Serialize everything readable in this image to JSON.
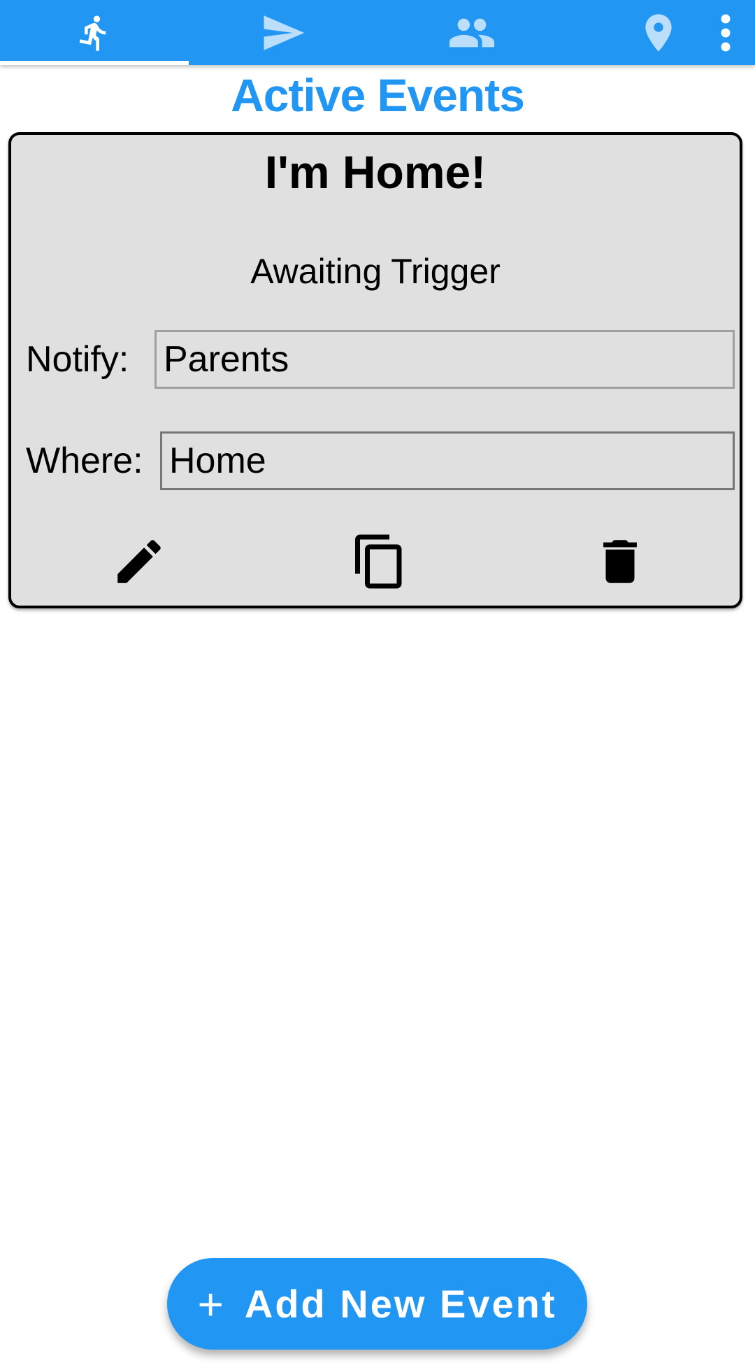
{
  "tabs": [
    {
      "id": "events",
      "icon": "run-icon",
      "selected": true
    },
    {
      "id": "send",
      "icon": "send-icon",
      "selected": false
    },
    {
      "id": "contacts",
      "icon": "people-icon",
      "selected": false
    },
    {
      "id": "places",
      "icon": "location-pin-icon",
      "selected": false
    }
  ],
  "overflow_icon": "more-vert-icon",
  "page": {
    "title": "Active Events"
  },
  "events": [
    {
      "title": "I'm Home!",
      "status": "Awaiting Trigger",
      "notify_label": "Notify:",
      "notify_value": "Parents",
      "where_label": "Where:",
      "where_value": "Home",
      "actions": [
        "edit-icon",
        "copy-icon",
        "delete-icon"
      ]
    }
  ],
  "fab": {
    "icon": "+",
    "label": "Add New Event"
  },
  "colors": {
    "primary": "#2196F3",
    "card_bg": "#e0e0e0",
    "inactive_icon": "#bbdefb"
  }
}
